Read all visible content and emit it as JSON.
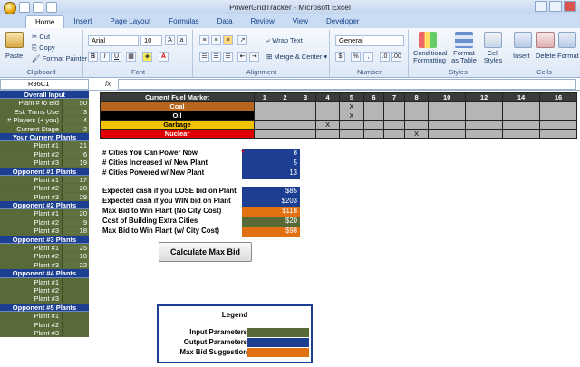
{
  "window": {
    "title": "PowerGridTracker - Microsoft Excel"
  },
  "tabs": [
    "Home",
    "Insert",
    "Page Layout",
    "Formulas",
    "Data",
    "Review",
    "View",
    "Developer"
  ],
  "ribbon": {
    "clipboard": {
      "paste": "Paste",
      "cut": "Cut",
      "copy": "Copy",
      "format_painter": "Format Painter",
      "label": "Clipboard"
    },
    "font": {
      "name": "Arial",
      "size": "10",
      "label": "Font"
    },
    "alignment": {
      "wrap": "Wrap Text",
      "merge": "Merge & Center",
      "label": "Alignment"
    },
    "number": {
      "format": "General",
      "label": "Number"
    },
    "styles": {
      "conditional": "Conditional Formatting",
      "format_table": "Format as Table",
      "cell_styles": "Cell Styles",
      "label": "Styles"
    },
    "cells": {
      "insert": "Insert",
      "delete": "Delete",
      "format": "Format",
      "label": "Cells"
    }
  },
  "formula_bar": {
    "name_box": "R36C1",
    "fx": "fx",
    "content": ""
  },
  "sidebar": {
    "overall": {
      "header": "Overall Input",
      "rows": [
        {
          "label": "Plant # to Bid",
          "value": "50"
        },
        {
          "label": "Est. Turns Use",
          "value": "3"
        },
        {
          "label": "# Players (+ you)",
          "value": "4"
        },
        {
          "label": "Current Stage",
          "value": "2"
        }
      ]
    },
    "your": {
      "header": "Your Current Plants",
      "rows": [
        {
          "label": "Plant #1",
          "value": "21"
        },
        {
          "label": "Plant #2",
          "value": "6"
        },
        {
          "label": "Plant #3",
          "value": "19"
        }
      ]
    },
    "opp1": {
      "header": "Opponent #1 Plants",
      "rows": [
        {
          "label": "Plant #1",
          "value": "17"
        },
        {
          "label": "Plant #2",
          "value": "28"
        },
        {
          "label": "Plant #3",
          "value": "29"
        }
      ]
    },
    "opp2": {
      "header": "Opponent #2 Plants",
      "rows": [
        {
          "label": "Plant #1",
          "value": "20"
        },
        {
          "label": "Plant #2",
          "value": "9"
        },
        {
          "label": "Plant #3",
          "value": "18"
        }
      ]
    },
    "opp3": {
      "header": "Opponent #3 Plants",
      "rows": [
        {
          "label": "Plant #1",
          "value": "25"
        },
        {
          "label": "Plant #2",
          "value": "10"
        },
        {
          "label": "Plant #3",
          "value": "22"
        }
      ]
    },
    "opp4": {
      "header": "Opponent #4 Plants",
      "rows": [
        {
          "label": "Plant #1",
          "value": ""
        },
        {
          "label": "Plant #2",
          "value": ""
        },
        {
          "label": "Plant #3",
          "value": ""
        }
      ]
    },
    "opp5": {
      "header": "Opponent #5 Plants",
      "rows": [
        {
          "label": "Plant #1",
          "value": ""
        },
        {
          "label": "Plant #2",
          "value": ""
        },
        {
          "label": "Plant #3",
          "value": ""
        }
      ]
    }
  },
  "fuel_market": {
    "title": "Current Fuel Market",
    "columns": [
      "1",
      "2",
      "3",
      "4",
      "5",
      "6",
      "7",
      "8",
      "10",
      "12",
      "14",
      "16"
    ],
    "rows": [
      {
        "name": "Coal",
        "color": "#b5651d",
        "marks": [
          "",
          "",
          "",
          "",
          "X",
          "",
          "",
          "",
          "",
          "",
          "",
          ""
        ]
      },
      {
        "name": "Oil",
        "color": "#000000",
        "marks": [
          "",
          "",
          "",
          "",
          "X",
          "",
          "",
          "",
          "",
          "",
          "",
          ""
        ]
      },
      {
        "name": "Garbage",
        "color": "#f2c100",
        "marks": [
          "",
          "",
          "",
          "X",
          "",
          "",
          "",
          "",
          "",
          "",
          "",
          ""
        ]
      },
      {
        "name": "Nuclear",
        "color": "#e00000",
        "marks": [
          "",
          "",
          "",
          "",
          "",
          "",
          "",
          "X",
          "",
          "",
          "",
          ""
        ]
      }
    ]
  },
  "calculations": [
    {
      "label": "# Cities You Can Power Now",
      "value": "8",
      "type": "output"
    },
    {
      "label": "# Cities Increased w/ New Plant",
      "value": "5",
      "type": "output"
    },
    {
      "label": "# Cities Powered w/ New Plant",
      "value": "13",
      "type": "output"
    },
    {
      "label": "Expected cash if you LOSE bid on Plant",
      "value": "$85",
      "type": "output"
    },
    {
      "label": "Expected cash if you  WIN  bid on Plant",
      "value": "$203",
      "type": "output"
    },
    {
      "label": "Max Bid to Win Plant (No City Cost)",
      "value": "$118",
      "type": "bid"
    },
    {
      "label": "Cost of Building Extra Cities",
      "value": "$20",
      "type": "input"
    },
    {
      "label": "Max Bid to Win Plant (w/ City Cost)",
      "value": "$98",
      "type": "bid"
    }
  ],
  "button": {
    "label": "Calculate Max Bid"
  },
  "legend": {
    "title": "Legend",
    "items": [
      {
        "label": "Input Parameters",
        "color": "#586a37"
      },
      {
        "label": "Output Parameters",
        "color": "#1d3f92"
      },
      {
        "label": "Max Bid Suggestion",
        "color": "#e07010"
      }
    ]
  },
  "colors": {
    "input": "#586a37",
    "output": "#1d3f92",
    "bid": "#e07010",
    "header": "#1d3f92"
  }
}
